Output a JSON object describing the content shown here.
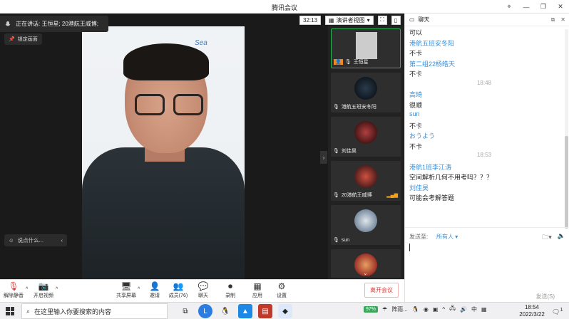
{
  "window": {
    "title": "腾讯会议",
    "controls": [
      "⌖",
      "—",
      "❐",
      "✕"
    ]
  },
  "stage": {
    "speaking_label": "正在讲话: 王恒星; 20港航王威博;",
    "lock_label": "锁定画面",
    "say_placeholder": "说点什么...",
    "timer": "32:13",
    "view_label": "演讲者视图",
    "video_overlay_text": "Sea"
  },
  "participants": [
    {
      "name": "王恒星",
      "active": true,
      "icon": "user-photo"
    },
    {
      "name": "港航五班安冬阳",
      "active": false,
      "avatar_color": "#101820"
    },
    {
      "name": "刘佳昊",
      "active": false,
      "avatar_color": "#5a1a1a"
    },
    {
      "name": "20港航王威博",
      "active": false,
      "avatar_color": "#c0392b"
    },
    {
      "name": "sun",
      "active": false,
      "avatar_color": "#6a7f96"
    },
    {
      "name": "",
      "active": false,
      "avatar_color": "#c0392b"
    }
  ],
  "chat": {
    "title": "聊天",
    "messages": [
      {
        "kind": "text",
        "text": "可以"
      },
      {
        "kind": "sender",
        "text": "港航五班安冬阳"
      },
      {
        "kind": "text",
        "text": "不卡"
      },
      {
        "kind": "sender",
        "text": "第二组22杨皓天"
      },
      {
        "kind": "text",
        "text": "不卡"
      },
      {
        "kind": "time",
        "text": "18:48"
      },
      {
        "kind": "sender",
        "text": "高琦"
      },
      {
        "kind": "text",
        "text": "很顺"
      },
      {
        "kind": "sender",
        "text": "sun"
      },
      {
        "kind": "text",
        "text": "不卡"
      },
      {
        "kind": "sender",
        "text": "おうよう"
      },
      {
        "kind": "text",
        "text": "不卡"
      },
      {
        "kind": "time",
        "text": "18:53"
      },
      {
        "kind": "sender",
        "text": "港航1班李江涛"
      },
      {
        "kind": "text",
        "text": "空间解析几何不用考吗？？？"
      },
      {
        "kind": "sender",
        "text": "刘佳昊"
      },
      {
        "kind": "text",
        "text": "可能会考解答题"
      }
    ],
    "send_to_label": "发送至:",
    "send_to_value": "所有人",
    "send_button": "发送(S)"
  },
  "toolbar": {
    "mute": "解除静音",
    "video": "开启视频",
    "share": "共享屏幕",
    "invite": "邀请",
    "members": "成员(76)",
    "chat": "聊天",
    "record": "录制",
    "apps": "应用",
    "settings": "设置",
    "leave": "离开会议"
  },
  "taskbar": {
    "search_placeholder": "在这里输入你要搜索的内容",
    "battery": "97%",
    "weather": "阵雨...",
    "ime": "中",
    "time": "18:54",
    "date": "2022/3/22",
    "notification_count": "1"
  }
}
